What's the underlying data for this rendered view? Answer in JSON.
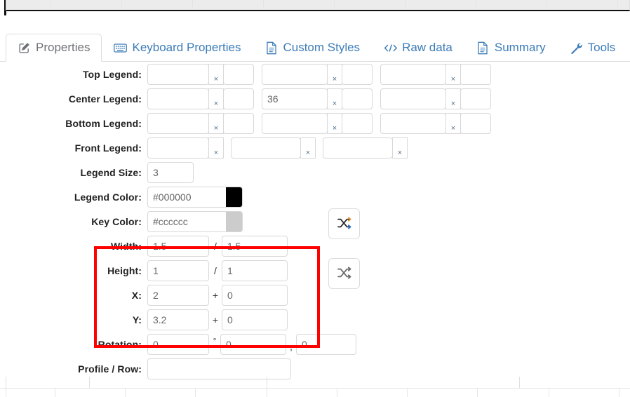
{
  "window": {
    "title": "Properties"
  },
  "tabs": [
    {
      "label": "Properties",
      "icon": "edit-square-icon",
      "active": true
    },
    {
      "label": "Keyboard Properties",
      "icon": "keyboard-icon",
      "active": false
    },
    {
      "label": "Custom Styles",
      "icon": "document-icon",
      "active": false
    },
    {
      "label": "Raw data",
      "icon": "code-icon",
      "active": false
    },
    {
      "label": "Summary",
      "icon": "document-icon",
      "active": false
    },
    {
      "label": "Tools",
      "icon": "wrench-icon",
      "active": false
    }
  ],
  "form": {
    "rows": {
      "top_legend": {
        "label": "Top Legend:",
        "groups": [
          {
            "text": "",
            "sep": "×",
            "num": ""
          },
          {
            "text": "",
            "sep": "×",
            "num": ""
          },
          {
            "text": "",
            "sep": "×",
            "num": ""
          }
        ]
      },
      "center_legend": {
        "label": "Center Legend:",
        "groups": [
          {
            "text": "",
            "sep": "×",
            "num": ""
          },
          {
            "text": "36",
            "sep": "×",
            "num": ""
          },
          {
            "text": "",
            "sep": "×",
            "num": ""
          }
        ]
      },
      "bottom_legend": {
        "label": "Bottom Legend:",
        "groups": [
          {
            "text": "",
            "sep": "×",
            "num": ""
          },
          {
            "text": "",
            "sep": "×",
            "num": ""
          },
          {
            "text": "",
            "sep": "×",
            "num": ""
          }
        ]
      },
      "front_legend": {
        "label": "Front Legend:",
        "groups": [
          {
            "text": "",
            "sep": "×"
          },
          {
            "text": "",
            "sep": "×"
          },
          {
            "text": "",
            "sep": "×"
          }
        ]
      },
      "legend_size": {
        "label": "Legend Size:",
        "value": "3"
      },
      "legend_color": {
        "label": "Legend Color:",
        "value": "#000000",
        "swatch": "#000000"
      },
      "key_color": {
        "label": "Key Color:",
        "value": "#cccccc",
        "swatch": "#cccccc"
      },
      "width": {
        "label": "Width:",
        "value_a": "1.5",
        "operator": "/",
        "value_b": "1.5"
      },
      "height": {
        "label": "Height:",
        "value_a": "1",
        "operator": "/",
        "value_b": "1"
      },
      "x": {
        "label": "X:",
        "value_a": "2",
        "operator": "+",
        "value_b": "0"
      },
      "y": {
        "label": "Y:",
        "value_a": "3.2",
        "operator": "+",
        "value_b": "0"
      },
      "rotation": {
        "label": "Rotation:",
        "value_a": "0",
        "operator_a": "°",
        "value_b": "0",
        "operator_b": ",",
        "value_c": "0"
      },
      "profile_row": {
        "label": "Profile / Row:",
        "value": ""
      }
    },
    "shuffle_buttons": [
      {
        "name": "shuffle-colors-button",
        "icon": "shuffle-icon",
        "color": "#e8931f"
      },
      {
        "name": "shuffle-dimensions-button",
        "icon": "shuffle-icon",
        "color": "#6a6a6a"
      }
    ]
  },
  "annotation": {
    "highlight_color": "#fe0000",
    "note": "red rectangle highlighting Width / Height / X / Y fields"
  }
}
